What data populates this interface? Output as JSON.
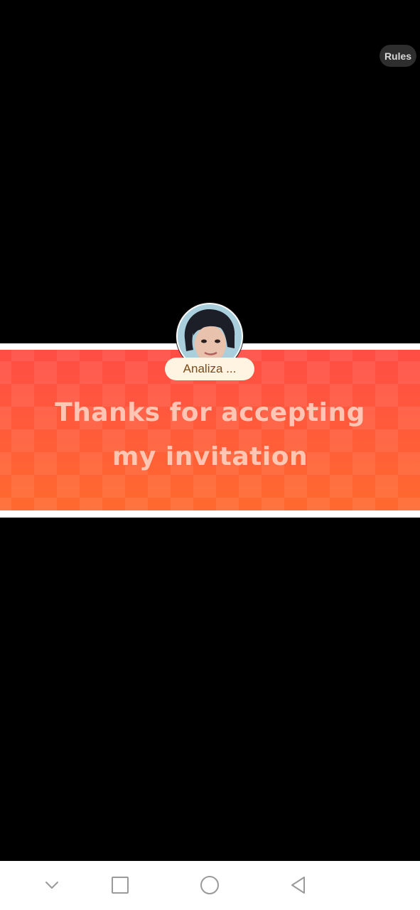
{
  "header": {
    "rules_label": "Rules"
  },
  "inviter": {
    "name": "Analiza ..."
  },
  "banner": {
    "line1": "Thanks for accepting",
    "line2": "my invitation"
  },
  "colors": {
    "banner_top": "#ff4d45",
    "banner_bottom": "#ff6a2e",
    "name_pill_bg": "#fff3e2",
    "name_pill_text": "#7a4a16"
  },
  "navbar": {
    "icons": [
      "chevron-down-icon",
      "recent-apps-icon",
      "home-icon",
      "back-icon"
    ]
  }
}
